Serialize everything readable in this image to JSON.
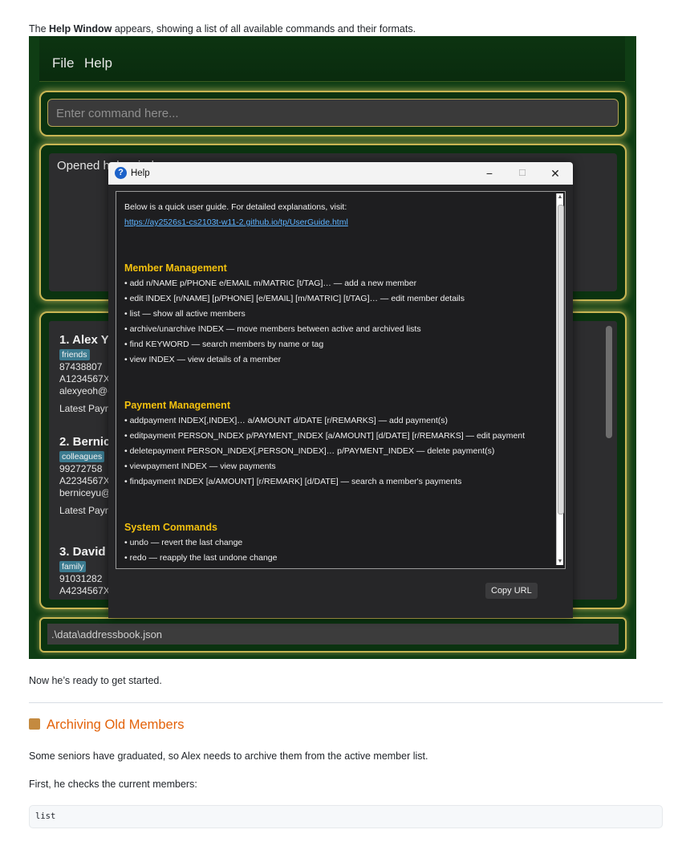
{
  "doc": {
    "intro_prefix": "The ",
    "intro_bold": "Help Window",
    "intro_suffix": " appears, showing a list of all available commands and their formats.",
    "after_text": "Now he’s ready to get started.",
    "section_title": "Archiving Old Members",
    "section_icon": "package-icon",
    "para1": "Some seniors have graduated, so Alex needs to archive them from the active member list.",
    "para2": "First, he checks the current members:",
    "code": "list"
  },
  "app": {
    "menu": [
      "File",
      "Help"
    ],
    "command_placeholder": "Enter command here...",
    "result_text": "Opened help window.",
    "members": [
      {
        "name": "1. Alex Yeoh",
        "tag": "friends",
        "phone": "87438807",
        "matric": "A1234567X",
        "email": "alexyeoh@example.com",
        "payment": "Latest Payment"
      },
      {
        "name": "2. Bernice Yu",
        "tag": "colleagues",
        "phone": "99272758",
        "matric": "A2234567X",
        "email": "berniceyu@example.com",
        "payment": "Latest Payment"
      },
      {
        "name": "3. David Li",
        "tag": "family",
        "phone": "91031282",
        "matric": "A4234567X"
      }
    ],
    "status_path": ".\\data\\addressbook.json"
  },
  "help": {
    "title": "Help",
    "intro": "Below is a quick user guide. For detailed explanations, visit:",
    "url": "https://ay2526s1-cs2103t-w11-2.github.io/tp/UserGuide.html",
    "sections": [
      {
        "title": "Member Management",
        "items": [
          "• add n/NAME p/PHONE e/EMAIL m/MATRIC [t/TAG]… — add a new member",
          "• edit INDEX [n/NAME] [p/PHONE] [e/EMAIL] [m/MATRIC] [t/TAG]… — edit member details",
          "• list — show all active members",
          "• archive/unarchive INDEX — move members between active and archived lists",
          "• find KEYWORD — search members by name or tag",
          "• view INDEX — view details of a member"
        ]
      },
      {
        "title": "Payment Management",
        "items": [
          "• addpayment INDEX[,INDEX]… a/AMOUNT d/DATE [r/REMARKS] — add payment(s)",
          "• editpayment PERSON_INDEX p/PAYMENT_INDEX [a/AMOUNT] [d/DATE] [r/REMARKS] — edit payment",
          "• deletepayment PERSON_INDEX[,PERSON_INDEX]… p/PAYMENT_INDEX — delete payment(s)",
          "• viewpayment INDEX — view payments",
          "• findpayment INDEX [a/AMOUNT] [r/REMARK] [d/DATE] — search a member's payments"
        ]
      },
      {
        "title": "System Commands",
        "items": [
          "• undo — revert the last change",
          "• redo — reapply the last undone change"
        ]
      }
    ],
    "copy_button": "Copy URL"
  }
}
